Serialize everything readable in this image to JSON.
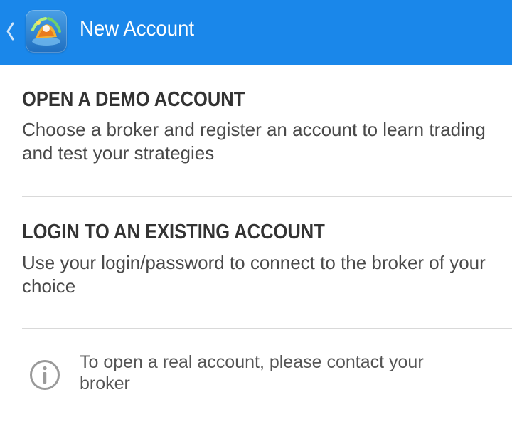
{
  "app_bar": {
    "title": "New Account",
    "background_color": "#1a87ea",
    "back_icon": "chevron-left-icon",
    "logo_icon": "metatrader-logo-icon"
  },
  "options": [
    {
      "title": "OPEN A DEMO ACCOUNT",
      "description": "Choose a broker and register an account to learn trading and test your strategies"
    },
    {
      "title": "LOGIN TO AN EXISTING ACCOUNT",
      "description": "Use your login/password to connect to the broker of your choice"
    }
  ],
  "info": {
    "icon": "info-icon",
    "text": "To open a real account, please contact your broker"
  }
}
